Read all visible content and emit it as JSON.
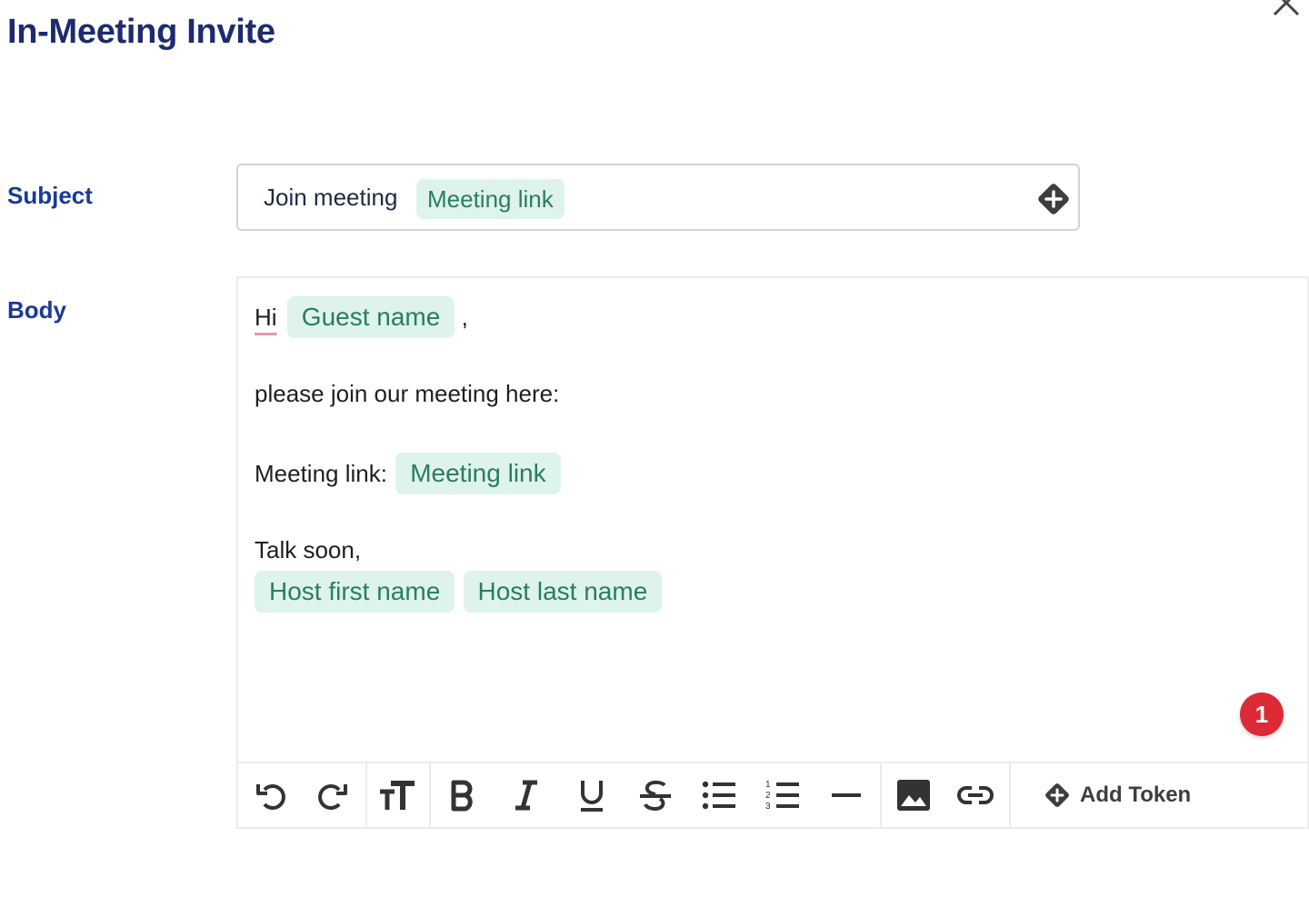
{
  "dialog": {
    "title": "In-Meeting Invite",
    "close_icon": "close-icon"
  },
  "subject": {
    "label": "Subject",
    "text": "Join meeting",
    "token": "Meeting link",
    "add_token_icon": "add-token-icon"
  },
  "body": {
    "label": "Body",
    "greeting": "Hi",
    "guest_token": "Guest name",
    "greeting_punct": ",",
    "line2": "please join our meeting here:",
    "link_label": "Meeting link:",
    "link_token": "Meeting link",
    "signoff": "Talk soon,",
    "host_first_token": "Host first name",
    "host_last_token": "Host last name",
    "badge_count": "1"
  },
  "toolbar": {
    "buttons": [
      "undo-icon",
      "redo-icon",
      "font-size-icon",
      "bold-icon",
      "italic-icon",
      "underline-icon",
      "strikethrough-icon",
      "bulleted-list-icon",
      "numbered-list-icon",
      "horizontal-rule-icon",
      "image-icon",
      "link-icon"
    ],
    "add_token_label": "Add Token"
  },
  "colors": {
    "title": "#1d2b6e",
    "label": "#1a3a94",
    "token_bg": "#def3ec",
    "token_text": "#2a7d5f",
    "badge": "#dc2a36"
  }
}
